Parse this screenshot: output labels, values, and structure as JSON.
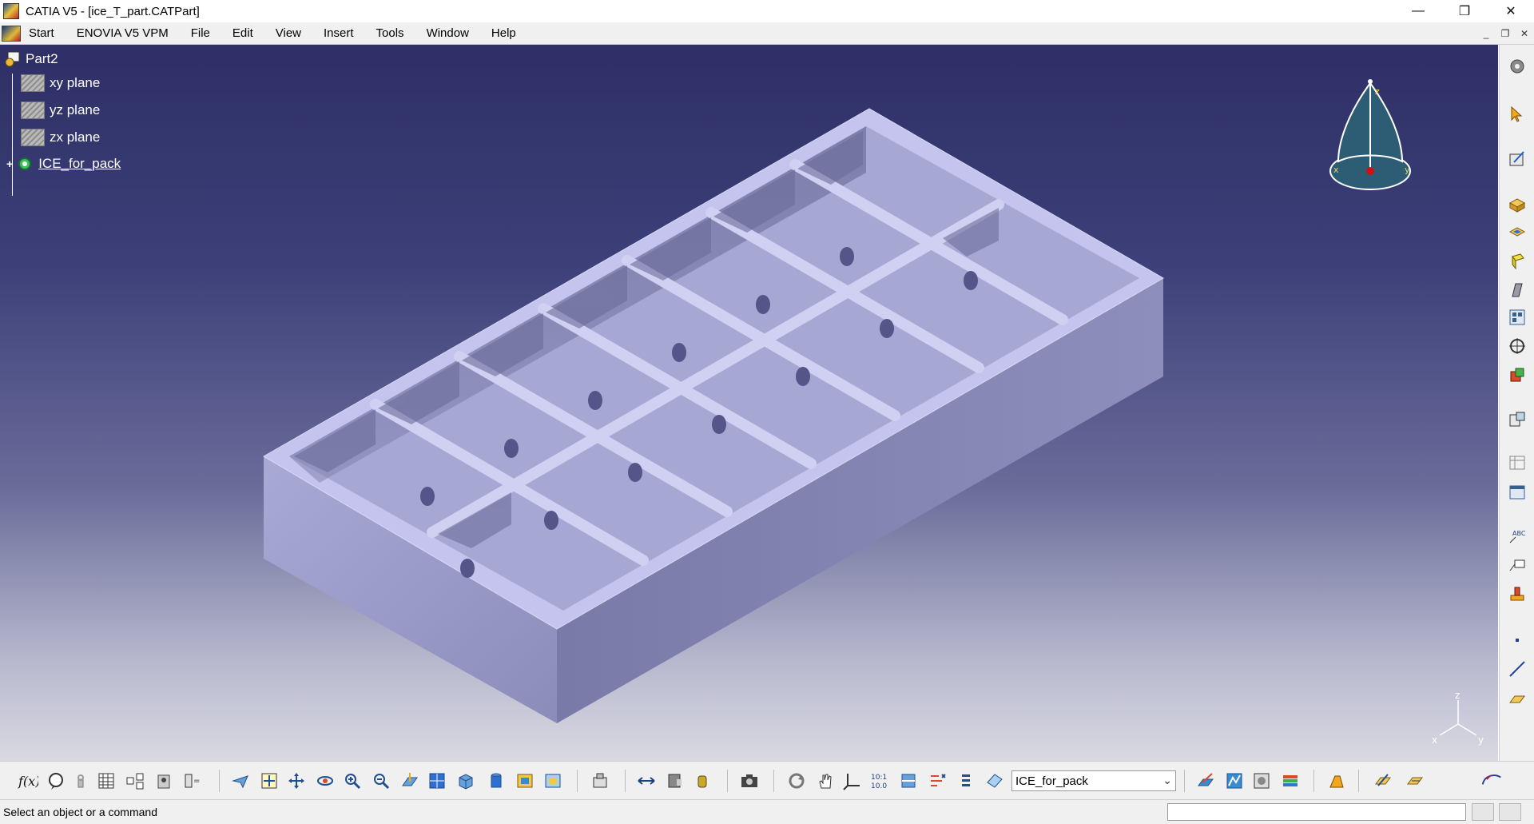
{
  "window": {
    "title": "CATIA V5 - [ice_T_part.CATPart]",
    "controls": [
      "—",
      "❐",
      "✕"
    ]
  },
  "menu": {
    "items": [
      "Start",
      "ENOVIA V5 VPM",
      "File",
      "Edit",
      "View",
      "Insert",
      "Tools",
      "Window",
      "Help"
    ],
    "mdi_controls": [
      "_",
      "❐",
      "✕"
    ]
  },
  "tree": {
    "root": "Part2",
    "planes": [
      "xy plane",
      "yz plane",
      "zx plane"
    ],
    "body": "ICE_for_pack"
  },
  "compass": {
    "z": "z",
    "x": "x",
    "y": "y"
  },
  "axis_triad": {
    "z": "z",
    "x": "x",
    "y": "y"
  },
  "bottom_toolbar": {
    "current_body": "ICE_for_pack",
    "zoom_label_top": "10:1",
    "zoom_label_bottom": "10.0"
  },
  "status": {
    "message": "Select an object or a command"
  },
  "colors": {
    "part": "#b8b8e6",
    "background_top": "#2e2f66",
    "background_bottom": "#d9d9e2",
    "compass": "#2c5d75"
  }
}
